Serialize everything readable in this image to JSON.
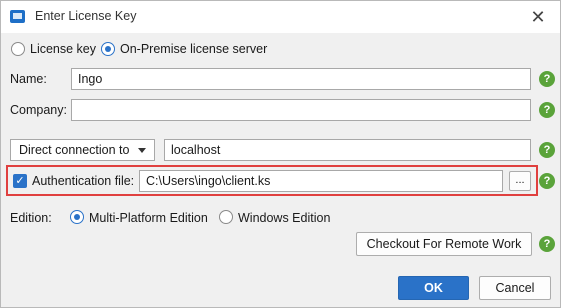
{
  "window": {
    "title": "Enter License Key",
    "close_glyph": "✕"
  },
  "license_type": {
    "option1": "License key",
    "option2": "On-Premise license server",
    "selected": "On-Premise license server"
  },
  "form": {
    "name_label": "Name:",
    "name_value": "Ingo",
    "company_label": "Company:",
    "company_value": "",
    "connection_mode": "Direct connection to",
    "server_value": "localhost",
    "auth_label": "Authentication file:",
    "auth_checked": true,
    "auth_value": "C:\\Users\\ingo\\client.ks",
    "browse_label": "..."
  },
  "edition": {
    "label": "Edition:",
    "option1": "Multi-Platform Edition",
    "option2": "Windows Edition",
    "selected": "Multi-Platform Edition"
  },
  "buttons": {
    "checkout": "Checkout For Remote Work",
    "ok": "OK",
    "cancel": "Cancel"
  },
  "help_glyph": "?",
  "colors": {
    "accent": "#2a72c8",
    "help": "#5aa33a",
    "highlight": "#e0403f"
  },
  "icons": {
    "app": "monitor-icon",
    "help": "question-icon",
    "check": "checkmark-icon"
  }
}
